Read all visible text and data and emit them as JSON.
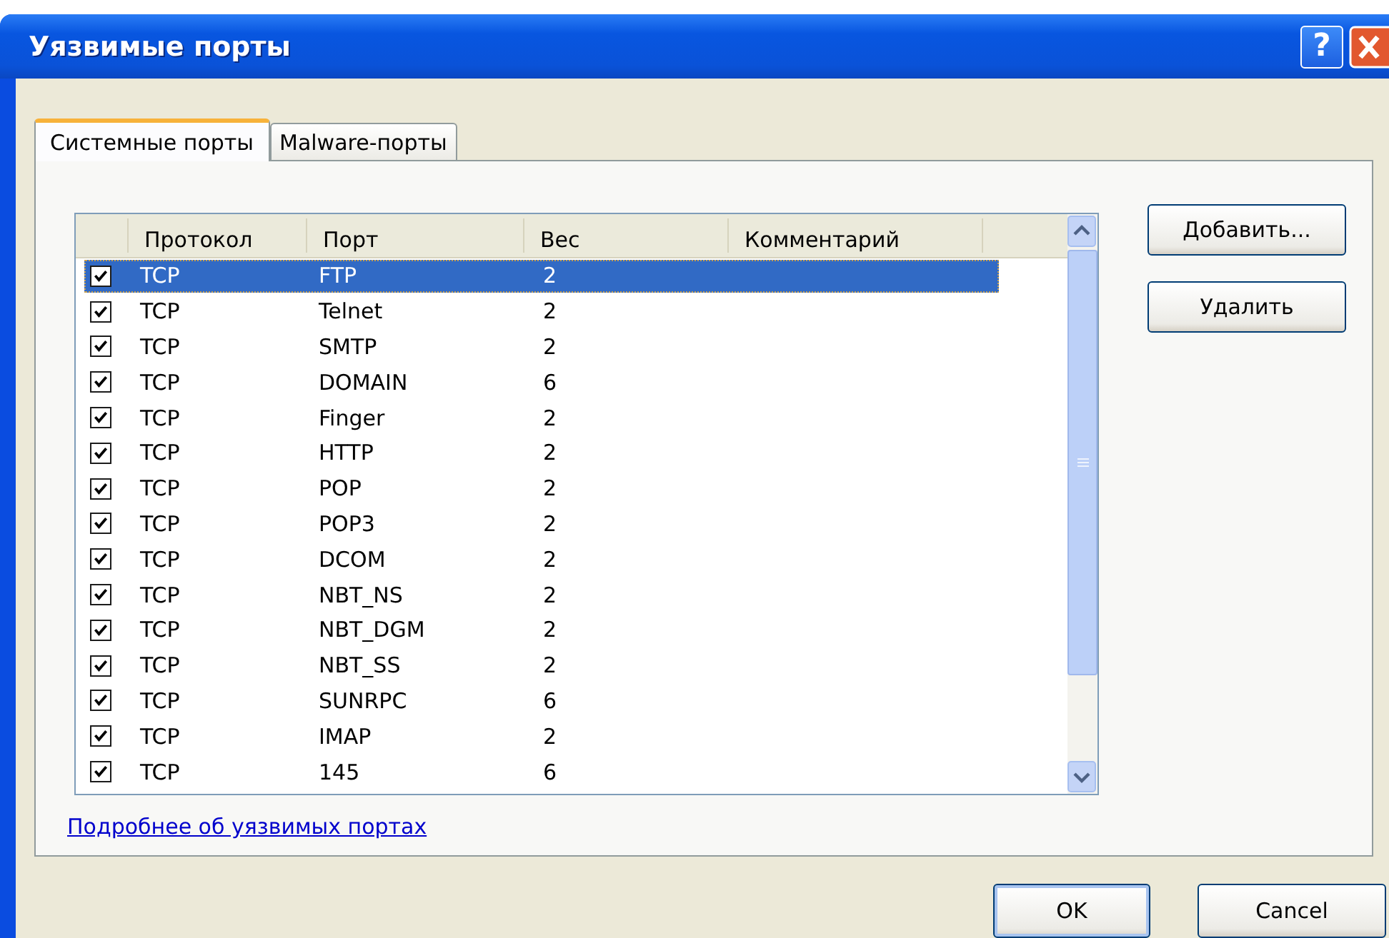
{
  "window": {
    "title": "Уязвимые порты",
    "help_button": "?"
  },
  "tabs": [
    {
      "label": "Системные порты",
      "selected": true
    },
    {
      "label": "Malware-порты",
      "selected": false
    }
  ],
  "table": {
    "columns": [
      "Протокол",
      "Порт",
      "Вес",
      "Комментарий"
    ],
    "rows": [
      {
        "checked": true,
        "selected": true,
        "protocol": "TCP",
        "port": "FTP",
        "weight": "2"
      },
      {
        "checked": true,
        "selected": false,
        "protocol": "TCP",
        "port": "Telnet",
        "weight": "2"
      },
      {
        "checked": true,
        "selected": false,
        "protocol": "TCP",
        "port": "SMTP",
        "weight": "2"
      },
      {
        "checked": true,
        "selected": false,
        "protocol": "TCP",
        "port": "DOMAIN",
        "weight": "6"
      },
      {
        "checked": true,
        "selected": false,
        "protocol": "TCP",
        "port": "Finger",
        "weight": "2"
      },
      {
        "checked": true,
        "selected": false,
        "protocol": "TCP",
        "port": "HTTP",
        "weight": "2"
      },
      {
        "checked": true,
        "selected": false,
        "protocol": "TCP",
        "port": "POP",
        "weight": "2"
      },
      {
        "checked": true,
        "selected": false,
        "protocol": "TCP",
        "port": "POP3",
        "weight": "2"
      },
      {
        "checked": true,
        "selected": false,
        "protocol": "TCP",
        "port": "DCOM",
        "weight": "2"
      },
      {
        "checked": true,
        "selected": false,
        "protocol": "TCP",
        "port": "NBT_NS",
        "weight": "2"
      },
      {
        "checked": true,
        "selected": false,
        "protocol": "TCP",
        "port": "NBT_DGM",
        "weight": "2"
      },
      {
        "checked": true,
        "selected": false,
        "protocol": "TCP",
        "port": "NBT_SS",
        "weight": "2"
      },
      {
        "checked": true,
        "selected": false,
        "protocol": "TCP",
        "port": "SUNRPC",
        "weight": "6"
      },
      {
        "checked": true,
        "selected": false,
        "protocol": "TCP",
        "port": "IMAP",
        "weight": "2"
      },
      {
        "checked": true,
        "selected": false,
        "protocol": "TCP",
        "port": "145",
        "weight": "6"
      }
    ]
  },
  "side_buttons": [
    "Добавить...",
    "Удалить"
  ],
  "link": "Подробнее об уязвимых портах",
  "buttons": [
    "OK",
    "Cancel"
  ]
}
